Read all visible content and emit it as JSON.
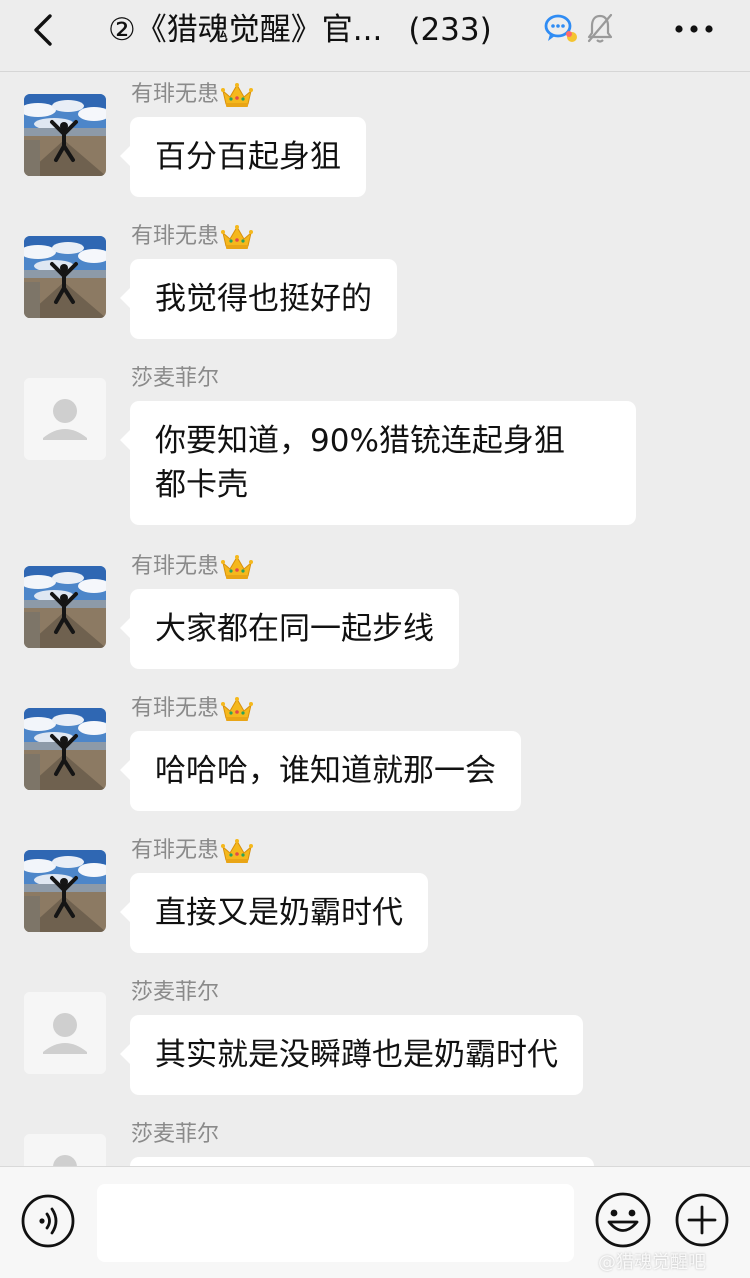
{
  "header": {
    "title": "②《猎魂觉醒》官",
    "title_ellipsis": "...",
    "member_count": "(233)",
    "back_icon": "chevron-left-icon",
    "chat_icon": "group-chat-icon",
    "mute_icon": "bell-muted-icon",
    "more_icon": "more-dots-icon"
  },
  "messages": [
    {
      "sender": "有琲无患",
      "badge": "crown-icon",
      "avatar": "photo-person-jumping",
      "text": "百分百起身狙"
    },
    {
      "sender": "有琲无患",
      "badge": "crown-icon",
      "avatar": "photo-person-jumping",
      "text": "我觉得也挺好的"
    },
    {
      "sender": "莎麦菲尔",
      "badge": "",
      "avatar": "default-user-avatar",
      "text_line1": "你要知道，90%猎铳连起身狙",
      "text_line2": "都卡壳"
    },
    {
      "sender": "有琲无患",
      "badge": "crown-icon",
      "avatar": "photo-person-jumping",
      "text": "大家都在同一起步线"
    },
    {
      "sender": "有琲无患",
      "badge": "crown-icon",
      "avatar": "photo-person-jumping",
      "text": "哈哈哈，谁知道就那一会"
    },
    {
      "sender": "有琲无患",
      "badge": "crown-icon",
      "avatar": "photo-person-jumping",
      "text": "直接又是奶霸时代"
    },
    {
      "sender": "莎麦菲尔",
      "badge": "",
      "avatar": "default-user-avatar",
      "text": "其实就是没瞬蹲也是奶霸时代"
    },
    {
      "sender": "莎麦菲尔",
      "badge": "",
      "avatar": "default-user-avatar",
      "text": ""
    }
  ],
  "input_bar": {
    "voice_icon": "voice-icon",
    "input_value": "",
    "input_placeholder": "",
    "emoji_icon": "emoji-smile-icon",
    "plus_icon": "plus-circle-icon"
  },
  "watermark": "@猎魂觉醒吧",
  "colors": {
    "background": "#ededed",
    "bubble": "#ffffff",
    "sender_name": "#8a8a8a",
    "crown": "#f5b81c",
    "chat_icon_blue": "#2f8cf4"
  }
}
